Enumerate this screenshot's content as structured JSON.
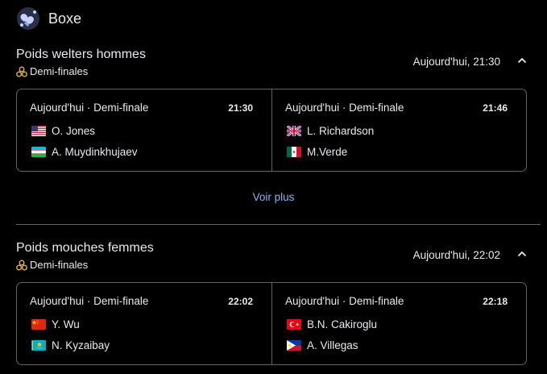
{
  "header": {
    "title": "Boxe",
    "icon": "boxing-gloves-icon"
  },
  "more_label": "Voir plus",
  "colors": {
    "link": "#8ab4f8",
    "border": "#5f6368",
    "text": "#e8eaed",
    "background": "#000000"
  },
  "sections": [
    {
      "title": "Poids welters hommes",
      "subtitle": "Demi-finales",
      "time": "Aujourd'hui, 21:30",
      "matches": [
        {
          "header": "Aujourd'hui · Demi-finale",
          "time": "21:30",
          "players": [
            {
              "name": "O. Jones",
              "flag": "usa-flag-icon"
            },
            {
              "name": "A. Muydinkhujaev",
              "flag": "uzbekistan-flag-icon"
            }
          ]
        },
        {
          "header": "Aujourd'hui · Demi-finale",
          "time": "21:46",
          "players": [
            {
              "name": "L. Richardson",
              "flag": "uk-flag-icon"
            },
            {
              "name": "M.Verde",
              "flag": "mexico-flag-icon"
            }
          ]
        }
      ]
    },
    {
      "title": "Poids mouches femmes",
      "subtitle": "Demi-finales",
      "time": "Aujourd'hui, 22:02",
      "matches": [
        {
          "header": "Aujourd'hui · Demi-finale",
          "time": "22:02",
          "players": [
            {
              "name": "Y. Wu",
              "flag": "china-flag-icon"
            },
            {
              "name": "N. Kyzaibay",
              "flag": "kazakhstan-flag-icon"
            }
          ]
        },
        {
          "header": "Aujourd'hui · Demi-finale",
          "time": "22:18",
          "players": [
            {
              "name": "B.N. Cakiroglu",
              "flag": "turkey-flag-icon"
            },
            {
              "name": "A. Villegas",
              "flag": "philippines-flag-icon"
            }
          ]
        }
      ]
    }
  ]
}
